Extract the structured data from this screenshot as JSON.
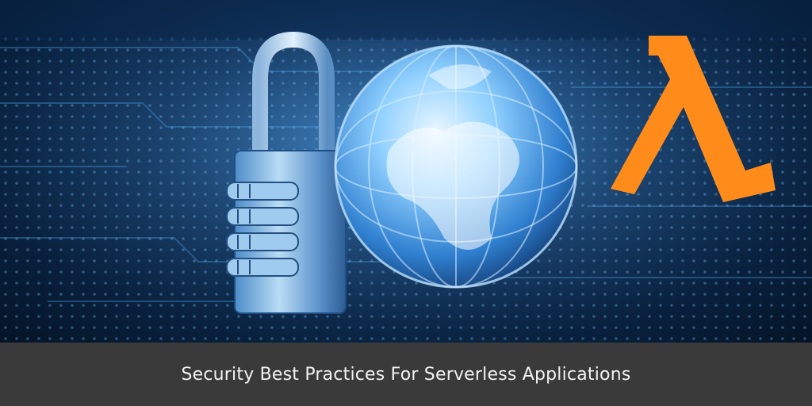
{
  "caption": "Security Best Practices For Serverless Applications",
  "hero": {
    "illustration": [
      "circuit-board-background",
      "padlock-icon",
      "globe-icon",
      "lambda-icon"
    ],
    "lambda_color": "#ff8c1a",
    "accent_color": "#6fc3ff"
  }
}
